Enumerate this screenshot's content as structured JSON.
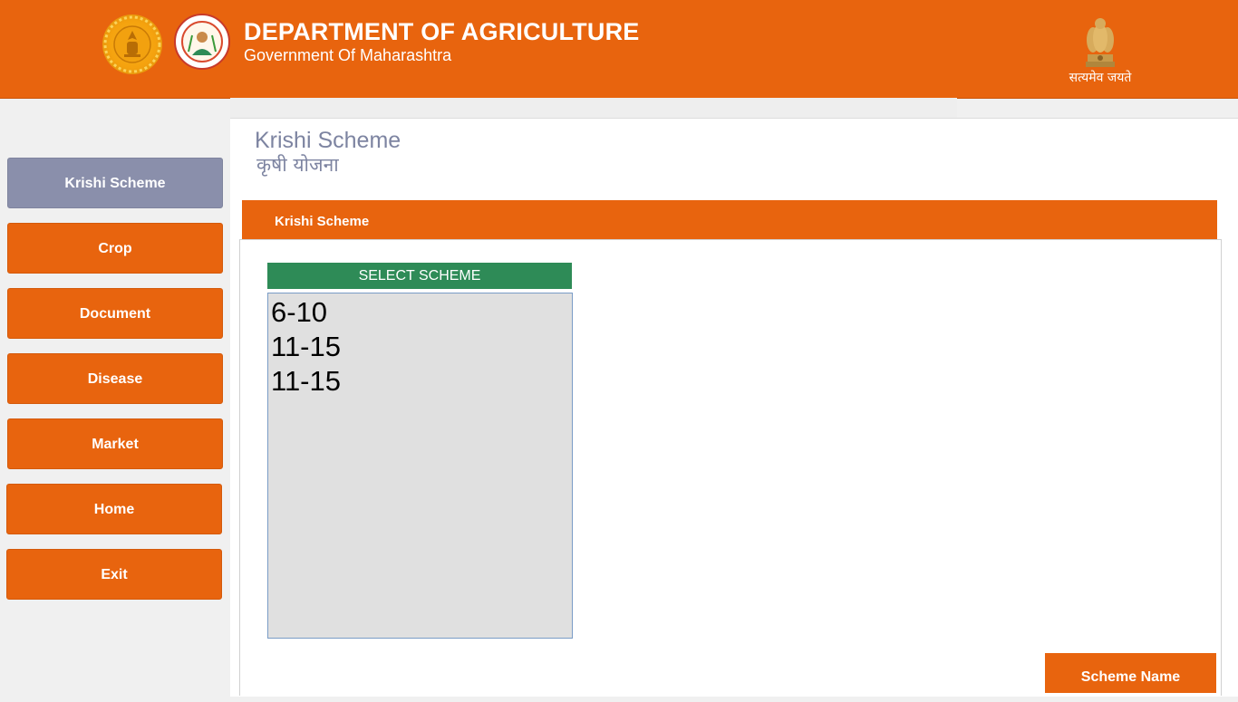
{
  "header": {
    "title": "DEPARTMENT OF AGRICULTURE",
    "subtitle": "Government Of Maharashtra",
    "motto": "सत्यमेव जयते",
    "logos": [
      "maharashtra-seal-icon",
      "agriculture-dept-logo-icon",
      "ashoka-emblem-icon"
    ]
  },
  "sidebar": {
    "items": [
      {
        "label": "Krishi Scheme",
        "active": true
      },
      {
        "label": "Crop"
      },
      {
        "label": "Document"
      },
      {
        "label": "Disease"
      },
      {
        "label": "Market"
      },
      {
        "label": "Home"
      },
      {
        "label": "Exit"
      }
    ]
  },
  "page": {
    "title": "Krishi Scheme",
    "title_hindi": "कृषी योजना"
  },
  "tab": {
    "label": "Krishi Scheme"
  },
  "scheme_list": {
    "header": "SELECT SCHEME",
    "items": [
      "6-10",
      "11-15",
      "11-15"
    ]
  },
  "actions": {
    "scheme_name_label": "Scheme Name"
  },
  "colors": {
    "accent": "#e8640e",
    "active_nav": "#8a8fab",
    "select_header": "#2e8b57",
    "title_text": "#7d84a1"
  }
}
